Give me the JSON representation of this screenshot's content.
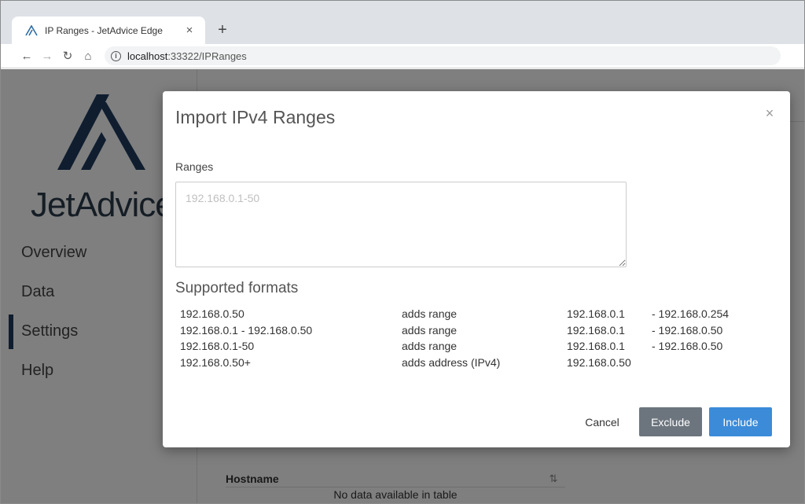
{
  "browser": {
    "tab_title": "IP Ranges - JetAdvice Edge",
    "tab_close": "×",
    "new_tab": "+",
    "url_host": "localhost",
    "url_rest": ":33322/IPRanges"
  },
  "sidebar": {
    "brand": "JetAdvice",
    "items": [
      {
        "label": "Overview"
      },
      {
        "label": "Data"
      },
      {
        "label": "Settings",
        "active": true
      },
      {
        "label": "Help"
      }
    ]
  },
  "table": {
    "header_hostname": "Hostname",
    "empty_message": "No data available in table"
  },
  "modal": {
    "title": "Import IPv4 Ranges",
    "close": "×",
    "ranges_label": "Ranges",
    "ranges_placeholder": "192.168.0.1-50",
    "formats_title": "Supported formats",
    "formats": [
      {
        "input": "192.168.0.50",
        "action": "adds range",
        "from": "192.168.0.1",
        "to": "- 192.168.0.254"
      },
      {
        "input": "192.168.0.1 - 192.168.0.50",
        "action": "adds range",
        "from": "192.168.0.1",
        "to": "- 192.168.0.50"
      },
      {
        "input": "192.168.0.1-50",
        "action": "adds range",
        "from": "192.168.0.1",
        "to": "- 192.168.0.50"
      },
      {
        "input": "192.168.0.50+",
        "action": "adds address (IPv4)",
        "from": "192.168.0.50",
        "to": ""
      }
    ],
    "buttons": {
      "cancel": "Cancel",
      "exclude": "Exclude",
      "include": "Include"
    }
  },
  "colors": {
    "brand_navy": "#1e3a5f",
    "include_blue": "#3b8bd9",
    "exclude_gray": "#6c757d"
  }
}
